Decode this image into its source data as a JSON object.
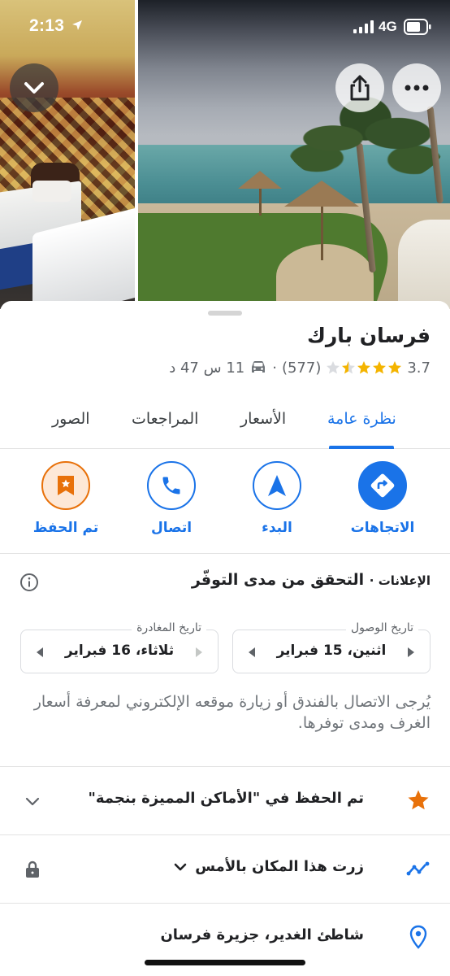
{
  "status_bar": {
    "time": "2:13",
    "network": "4G"
  },
  "header_buttons": {
    "collapse_icon": "chevron-down-icon",
    "share_icon": "share-icon",
    "more_icon": "more-horizontal-icon"
  },
  "place": {
    "title": "فرسان بارك",
    "rating": "3.7",
    "stars_filled": 3.5,
    "stars_total": 5,
    "review_count": "(577)",
    "separator": "·",
    "travel_mode_icon": "car-icon",
    "drive_time": "11 س 47 د"
  },
  "tabs": [
    {
      "label": "نظرة عامة",
      "active": true
    },
    {
      "label": "الأسعار",
      "active": false
    },
    {
      "label": "المراجعات",
      "active": false
    },
    {
      "label": "الصور",
      "active": false
    }
  ],
  "actions": [
    {
      "label": "الاتجاهات",
      "icon": "directions-icon"
    },
    {
      "label": "البدء",
      "icon": "navigation-icon"
    },
    {
      "label": "اتصال",
      "icon": "phone-icon"
    },
    {
      "label": "تم الحفظ",
      "icon": "saved-star-bookmark-icon"
    }
  ],
  "availability": {
    "ads_label": "الإعلانات ·",
    "title": "التحقق من مدى التوفّر",
    "arrival": {
      "label": "تاريخ الوصول",
      "value": "اثنين، 15 فبراير"
    },
    "departure": {
      "label": "تاريخ المغادرة",
      "value": "ثلاثاء، 16 فبراير"
    },
    "notice": "يُرجى الاتصال بالفندق أو زيارة موقعه الإلكتروني لمعرفة أسعار الغرف ومدى توفرها."
  },
  "rows": [
    {
      "text": "تم الحفظ في \"الأماكن المميزة بنجمة\"",
      "icon": "star-icon",
      "trailing": "chevron-down-icon"
    },
    {
      "text": "زرت هذا المكان بالأمس",
      "icon": "timeline-icon",
      "trailing": "lock-icon"
    },
    {
      "text": "شاطئ الغدير، جزيرة فرسان",
      "icon": "location-pin-icon"
    }
  ],
  "colors": {
    "accent": "#1a73e8",
    "star": "#f4b400",
    "saved": "#e8710a"
  }
}
